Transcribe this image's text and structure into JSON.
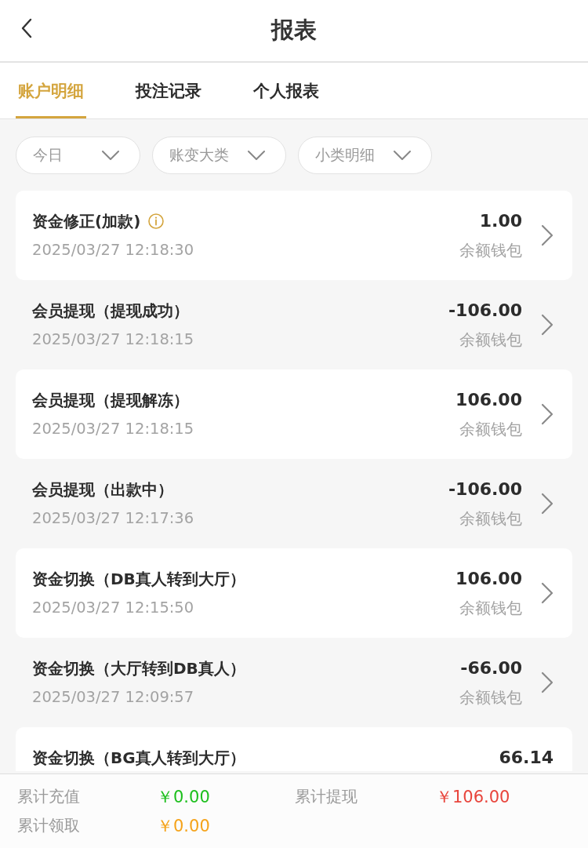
{
  "header": {
    "title": "报表"
  },
  "tabs": [
    {
      "label": "账户明细",
      "selected": true
    },
    {
      "label": "投注记录",
      "selected": false
    },
    {
      "label": "个人报表",
      "selected": false
    }
  ],
  "filters": [
    {
      "label": "今日"
    },
    {
      "label": "账变大类"
    },
    {
      "label": "小类明细"
    }
  ],
  "items": [
    {
      "title": "资金修正(加款)",
      "info": true,
      "time": "2025/03/27 12:18:30",
      "amount": "1.00",
      "wallet": "余额钱包"
    },
    {
      "title": "会员提现（提现成功）",
      "info": false,
      "time": "2025/03/27 12:18:15",
      "amount": "-106.00",
      "wallet": "余额钱包"
    },
    {
      "title": "会员提现（提现解冻）",
      "info": false,
      "time": "2025/03/27 12:18:15",
      "amount": "106.00",
      "wallet": "余额钱包"
    },
    {
      "title": "会员提现（出款中）",
      "info": false,
      "time": "2025/03/27 12:17:36",
      "amount": "-106.00",
      "wallet": "余额钱包"
    },
    {
      "title": "资金切换（DB真人转到大厅）",
      "info": false,
      "time": "2025/03/27 12:15:50",
      "amount": "106.00",
      "wallet": "余额钱包"
    },
    {
      "title": "资金切换（大厅转到DB真人）",
      "info": false,
      "time": "2025/03/27 12:09:57",
      "amount": "-66.00",
      "wallet": "余额钱包"
    },
    {
      "title": "资金切换（BG真人转到大厅）",
      "info": false,
      "amount": "66.14"
    }
  ],
  "summary": [
    {
      "label": "累计充值",
      "value": "￥0.00",
      "color": "#1dbf1d"
    },
    {
      "label": "累计提现",
      "value": "￥106.00",
      "color": "#e8453c"
    },
    {
      "label": "累计领取",
      "value": "￥0.00",
      "color": "#f5a31a"
    }
  ]
}
